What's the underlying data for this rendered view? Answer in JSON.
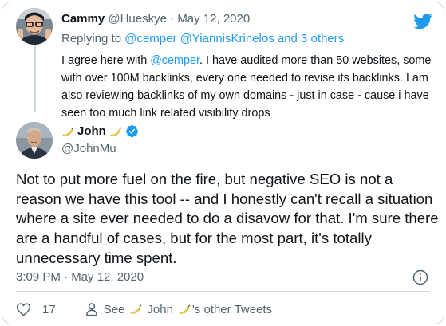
{
  "parent_tweet": {
    "display_name": "Cammy",
    "handle": "@Hueskye",
    "separator": "·",
    "date": "May 12, 2020",
    "replying_prefix": "Replying to",
    "replying_targets": "@cemper @YiannisKrinelos and 3 others",
    "text_before_mention": "I agree here with ",
    "mention": "@cemper",
    "text_after_mention": ". I have audited more than 50 websites, some with over 100M backlinks, every one needed to revise its backlinks. I am also reviewing backlinks of my own domains - just in case - cause i have seen too much link related visibility drops"
  },
  "main_tweet": {
    "display_name": "John",
    "handle": "@JohnMu",
    "text": "Not to put more fuel on the fire, but negative SEO is not a reason we have this tool -- and I honestly can't recall a situation where a site ever needed to do a disavow for that. I'm sure there are a handful of cases, but for the most part, it's totally unnecessary time spent.",
    "timestamp": "3:09 PM · May 12, 2020"
  },
  "footer": {
    "like_count": "17",
    "see_prefix": "See",
    "see_name": "John",
    "see_suffix": "'s other Tweets"
  },
  "icons": [
    "twitter-logo-icon",
    "verified-badge-icon",
    "banana-emoji-icon",
    "info-icon",
    "heart-icon",
    "user-icon"
  ],
  "colors": {
    "accent": "#1d9bf0",
    "text": "#0f1419",
    "muted": "#536471",
    "border": "#cfd9de",
    "banana": "#f7d44c"
  }
}
